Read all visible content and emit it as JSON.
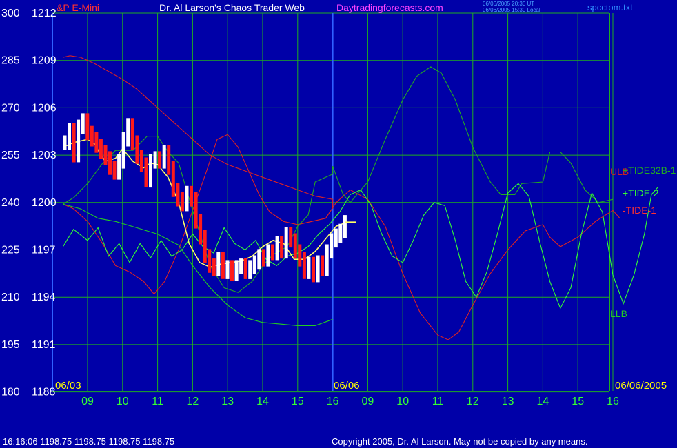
{
  "header": {
    "instrument": "&P E-Mini",
    "title": "Dr. Al Larson's Chaos Trader Web",
    "site": "Daytradingforecasts.com",
    "timestamp_ut": "06/06/2005 20:30 UT",
    "timestamp_local": "06/06/2005 15:30 Local",
    "filename": "spcctom.txt"
  },
  "footer": {
    "status": "16:16:06  1198.75 1198.75 1198.75 1198.75",
    "copyright": "Copyright 2005, Dr. Al Larson. May not be copied by any means."
  },
  "date_labels": {
    "left": "06/03",
    "middle": "06/06",
    "right": "06/06/2005"
  },
  "colors": {
    "background": "#0000a8",
    "grid": "#1fae1f",
    "price_up": "#ffffff",
    "price_down": "#ff1a1a",
    "ulb_tide1": "#dd2222",
    "tide32b1": "#22aa22",
    "tide2": "#33ff33",
    "llb": "#22cc22",
    "average": "#ffff66",
    "y_labels": "#ffffff",
    "x_labels": "#33ff33",
    "date_labels": "#ffff00"
  },
  "chart_data": {
    "type": "line",
    "title": "Dr. Al Larson's Chaos Trader Web",
    "y_axis_left": {
      "ticks": [
        300,
        285,
        270,
        255,
        240,
        225,
        210,
        195,
        180
      ],
      "range": [
        180,
        300
      ]
    },
    "y_axis_price": {
      "ticks": [
        1212,
        1209,
        1206,
        1203,
        1200,
        1197,
        1194,
        1191,
        1188
      ],
      "range": [
        1188,
        1212
      ]
    },
    "x_axis": {
      "ticks": [
        "09",
        "10",
        "11",
        "12",
        "13",
        "14",
        "15",
        "16",
        "09",
        "10",
        "11",
        "12",
        "13",
        "14",
        "15",
        "16"
      ],
      "range": [
        8.3,
        24
      ]
    },
    "series": [
      {
        "name": "ULB",
        "color": "#dd2222",
        "points": [
          [
            8.3,
            1209.2
          ],
          [
            8.5,
            1209.3
          ],
          [
            8.8,
            1209.2
          ],
          [
            9.2,
            1208.8
          ],
          [
            9.6,
            1208.3
          ],
          [
            10.0,
            1207.8
          ],
          [
            10.4,
            1207.2
          ],
          [
            10.8,
            1206.4
          ],
          [
            11.2,
            1205.6
          ],
          [
            11.6,
            1204.8
          ],
          [
            12.0,
            1204.0
          ],
          [
            12.5,
            1203.0
          ],
          [
            13.0,
            1202.4
          ],
          [
            13.5,
            1202.0
          ],
          [
            14.0,
            1201.6
          ],
          [
            14.5,
            1201.2
          ],
          [
            15.0,
            1200.8
          ],
          [
            15.5,
            1200.4
          ],
          [
            16.0,
            1200.2
          ],
          [
            16.0,
            1199.6
          ]
        ]
      },
      {
        "name": "-TIDE-1",
        "color": "#dd2222",
        "points": [
          [
            8.3,
            1199.9
          ],
          [
            8.6,
            1199.6
          ],
          [
            9.0,
            1198.8
          ],
          [
            9.4,
            1197.5
          ],
          [
            9.8,
            1196.0
          ],
          [
            10.2,
            1195.6
          ],
          [
            10.6,
            1195.0
          ],
          [
            10.9,
            1194.2
          ],
          [
            11.2,
            1195.0
          ],
          [
            11.6,
            1197.0
          ],
          [
            12.0,
            1199.5
          ],
          [
            12.4,
            1202.0
          ],
          [
            12.7,
            1204.0
          ],
          [
            13.0,
            1204.3
          ],
          [
            13.3,
            1203.5
          ],
          [
            13.6,
            1202.0
          ],
          [
            13.9,
            1200.5
          ],
          [
            14.2,
            1199.4
          ],
          [
            14.6,
            1198.8
          ],
          [
            15.0,
            1198.6
          ],
          [
            15.4,
            1198.8
          ],
          [
            15.8,
            1199.0
          ],
          [
            16.1,
            1200.0
          ],
          [
            16.5,
            1200.8
          ],
          [
            17.0,
            1200.2
          ],
          [
            17.5,
            1198.5
          ],
          [
            18.0,
            1195.5
          ],
          [
            18.5,
            1193.0
          ],
          [
            19.0,
            1191.6
          ],
          [
            19.3,
            1191.3
          ],
          [
            19.6,
            1191.8
          ],
          [
            20.0,
            1193.5
          ],
          [
            20.5,
            1195.5
          ],
          [
            21.0,
            1197.0
          ],
          [
            21.5,
            1198.2
          ],
          [
            22.0,
            1198.6
          ],
          [
            22.2,
            1197.8
          ],
          [
            22.5,
            1197.2
          ],
          [
            23.0,
            1197.8
          ],
          [
            23.5,
            1198.8
          ],
          [
            24.0,
            1199.5
          ],
          [
            24.2,
            1199.0
          ]
        ]
      },
      {
        "name": "+TIDE32B-1",
        "color": "#22aa22",
        "points": [
          [
            8.3,
            1199.9
          ],
          [
            8.6,
            1200.3
          ],
          [
            9.0,
            1201.2
          ],
          [
            9.4,
            1202.4
          ],
          [
            9.8,
            1203.3
          ],
          [
            10.3,
            1203.3
          ],
          [
            10.7,
            1204.2
          ],
          [
            11.0,
            1204.2
          ],
          [
            11.3,
            1203.2
          ],
          [
            11.6,
            1202.5
          ],
          [
            12.0,
            1199.5
          ],
          [
            12.5,
            1196.0
          ],
          [
            12.9,
            1194.6
          ],
          [
            13.3,
            1194.3
          ],
          [
            13.7,
            1195.0
          ],
          [
            14.0,
            1196.0
          ],
          [
            14.3,
            1196.7
          ],
          [
            14.7,
            1197.2
          ],
          [
            15.0,
            1198.5
          ],
          [
            15.3,
            1199.2
          ],
          [
            15.5,
            1201.3
          ],
          [
            16.0,
            1201.8
          ],
          [
            16.0,
            1202.3
          ],
          [
            16.3,
            1200.5
          ],
          [
            16.5,
            1200.0
          ],
          [
            17.0,
            1201.3
          ],
          [
            17.5,
            1204.0
          ],
          [
            18.0,
            1206.5
          ],
          [
            18.4,
            1208.0
          ],
          [
            18.8,
            1208.6
          ],
          [
            19.1,
            1208.2
          ],
          [
            19.5,
            1206.5
          ],
          [
            20.0,
            1203.5
          ],
          [
            20.5,
            1201.3
          ],
          [
            20.8,
            1200.5
          ],
          [
            21.2,
            1200.5
          ],
          [
            21.4,
            1201.2
          ],
          [
            22.0,
            1201.3
          ],
          [
            22.2,
            1203.2
          ],
          [
            22.5,
            1203.2
          ],
          [
            22.8,
            1202.5
          ],
          [
            23.2,
            1200.8
          ],
          [
            23.6,
            1200.0
          ],
          [
            24.0,
            1200.2
          ]
        ]
      },
      {
        "name": "LLB",
        "color": "#22cc22",
        "points": [
          [
            8.3,
            1199.9
          ],
          [
            8.8,
            1199.6
          ],
          [
            9.3,
            1199.0
          ],
          [
            9.8,
            1198.8
          ],
          [
            10.4,
            1198.4
          ],
          [
            11.0,
            1198.0
          ],
          [
            11.6,
            1197.3
          ],
          [
            12.0,
            1196.0
          ],
          [
            12.5,
            1194.6
          ],
          [
            13.0,
            1193.5
          ],
          [
            13.5,
            1192.7
          ],
          [
            14.0,
            1192.4
          ],
          [
            14.5,
            1192.3
          ],
          [
            15.0,
            1192.2
          ],
          [
            15.5,
            1192.2
          ],
          [
            16.0,
            1192.6
          ]
        ]
      },
      {
        "name": "+TIDE-2",
        "color": "#33ff33",
        "points": [
          [
            8.3,
            1197.2
          ],
          [
            8.6,
            1198.3
          ],
          [
            9.0,
            1197.6
          ],
          [
            9.3,
            1198.4
          ],
          [
            9.6,
            1196.6
          ],
          [
            9.9,
            1197.4
          ],
          [
            10.2,
            1196.2
          ],
          [
            10.5,
            1197.4
          ],
          [
            10.8,
            1196.5
          ],
          [
            11.1,
            1197.6
          ],
          [
            11.4,
            1196.6
          ],
          [
            11.7,
            1197.0
          ],
          [
            12.0,
            1198.0
          ],
          [
            12.3,
            1197.2
          ],
          [
            12.6,
            1196.8
          ],
          [
            12.9,
            1198.4
          ],
          [
            13.2,
            1197.4
          ],
          [
            13.5,
            1197.0
          ],
          [
            13.8,
            1197.6
          ],
          [
            14.1,
            1196.4
          ],
          [
            14.4,
            1196.0
          ],
          [
            14.7,
            1196.6
          ],
          [
            15.0,
            1196.8
          ],
          [
            15.3,
            1197.2
          ],
          [
            15.6,
            1198.0
          ],
          [
            15.9,
            1198.6
          ],
          [
            16.2,
            1199.4
          ],
          [
            16.5,
            1200.5
          ],
          [
            16.8,
            1200.8
          ],
          [
            17.1,
            1199.8
          ],
          [
            17.4,
            1198.0
          ],
          [
            17.7,
            1196.6
          ],
          [
            18.0,
            1196.2
          ],
          [
            18.3,
            1197.6
          ],
          [
            18.6,
            1199.2
          ],
          [
            18.9,
            1200.0
          ],
          [
            19.2,
            1199.8
          ],
          [
            19.5,
            1197.6
          ],
          [
            19.8,
            1195.0
          ],
          [
            20.1,
            1194.0
          ],
          [
            20.4,
            1195.6
          ],
          [
            20.7,
            1198.0
          ],
          [
            21.0,
            1200.6
          ],
          [
            21.3,
            1201.2
          ],
          [
            21.6,
            1200.4
          ],
          [
            21.9,
            1197.6
          ],
          [
            22.2,
            1195.0
          ],
          [
            22.5,
            1193.3
          ],
          [
            22.8,
            1194.6
          ],
          [
            23.1,
            1198.0
          ],
          [
            23.4,
            1200.6
          ],
          [
            23.7,
            1199.4
          ],
          [
            24.0,
            1195.4
          ],
          [
            24.3,
            1193.6
          ],
          [
            24.6,
            1195.4
          ],
          [
            24.9,
            1198.0
          ],
          [
            25.1,
            1200.5
          ],
          [
            25.3,
            1201.0
          ]
        ]
      },
      {
        "name": "Average",
        "color": "#ffff66",
        "points": [
          [
            8.4,
            1203.6
          ],
          [
            8.6,
            1203.8
          ],
          [
            8.8,
            1203.9
          ],
          [
            9.0,
            1204.0
          ],
          [
            9.2,
            1203.7
          ],
          [
            9.5,
            1202.6
          ],
          [
            9.8,
            1202.8
          ],
          [
            10.0,
            1203.4
          ],
          [
            10.3,
            1202.6
          ],
          [
            10.6,
            1202.2
          ],
          [
            10.8,
            1202.5
          ],
          [
            11.0,
            1202.4
          ],
          [
            11.3,
            1201.6
          ],
          [
            11.6,
            1200.0
          ],
          [
            11.9,
            1197.4
          ],
          [
            12.2,
            1196.2
          ],
          [
            12.5,
            1195.9
          ],
          [
            12.8,
            1196.1
          ],
          [
            13.1,
            1196.2
          ],
          [
            13.4,
            1196.3
          ],
          [
            13.7,
            1196.6
          ],
          [
            14.0,
            1197.2
          ],
          [
            14.3,
            1197.6
          ],
          [
            14.6,
            1197.4
          ],
          [
            14.9,
            1196.4
          ],
          [
            15.2,
            1196.4
          ],
          [
            15.5,
            1196.9
          ],
          [
            15.8,
            1197.7
          ],
          [
            16.1,
            1198.5
          ],
          [
            16.4,
            1198.75
          ]
        ]
      }
    ],
    "price_bars": {
      "description": "price bars, white = up, red = down",
      "close_values": [
        1203.8,
        1204.6,
        1203.0,
        1204.8,
        1205.2,
        1204.4,
        1204.0,
        1203.6,
        1203.2,
        1202.8,
        1202.2,
        1201.9,
        1202.6,
        1204.0,
        1204.9,
        1203.8,
        1202.9,
        1202.4,
        1201.4,
        1202.6,
        1202.8,
        1202.6,
        1203.2,
        1202.2,
        1200.8,
        1200.2,
        1199.9,
        1200.6,
        1200.2,
        1198.8,
        1197.8,
        1196.6,
        1196.0,
        1195.8,
        1196.4,
        1195.6,
        1195.9,
        1195.5,
        1195.9,
        1196.0,
        1195.6,
        1195.9,
        1196.2,
        1196.6,
        1196.4,
        1196.9,
        1196.8,
        1197.4,
        1196.9,
        1198.0,
        1197.6,
        1196.9,
        1196.4,
        1195.6,
        1196.1,
        1195.4,
        1196.2,
        1195.8,
        1196.9,
        1197.6,
        1197.9,
        1198.2,
        1198.75
      ],
      "last": 1198.75
    }
  }
}
